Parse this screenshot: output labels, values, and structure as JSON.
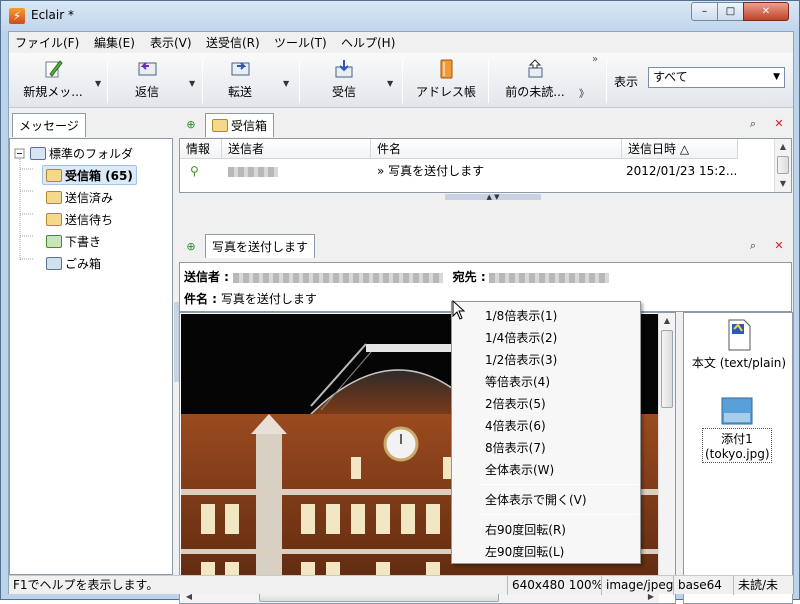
{
  "window": {
    "title": "Eclair *",
    "min": "–",
    "max": "□",
    "close": "✕"
  },
  "menu": [
    "ファイル(F)",
    "編集(E)",
    "表示(V)",
    "送受信(R)",
    "ツール(T)",
    "ヘルプ(H)"
  ],
  "toolbar": {
    "new_label": "新規メッ...",
    "reply_label": "返信",
    "forward_label": "転送",
    "receive_label": "受信",
    "address_label": "アドレス帳",
    "prev_unread_label": "前の未読...",
    "view_label": "表示",
    "view_selected": "すべて",
    "overflow": "»",
    "extra_label": "》"
  },
  "left": {
    "tab": "メッセージ",
    "folders": {
      "root": "標準のフォルダ",
      "inbox": "受信箱 (65)",
      "sent": "送信済み",
      "outbox": "送信待ち",
      "drafts": "下書き",
      "trash": "ごみ箱"
    }
  },
  "list": {
    "tab": "受信箱",
    "columns": {
      "info": "情報",
      "from": "送信者",
      "subject": "件名",
      "date": "送信日時 △"
    },
    "row": {
      "subject": "» 写真を送付します",
      "date": "2012/01/23 15:2..."
    }
  },
  "message": {
    "tab": "写真を送付します",
    "from_label": "送信者 :",
    "to_label": "宛先 :",
    "subject_label": "件名 :",
    "subject": "写真を送付します"
  },
  "attachments": {
    "body": "本文 (text/plain)",
    "attach1_line1": "添付1",
    "attach1_line2": "(tokyo.jpg)"
  },
  "context_menu": {
    "items_top": [
      "1/8倍表示(1)",
      "1/4倍表示(2)",
      "1/2倍表示(3)",
      "等倍表示(4)",
      "2倍表示(5)",
      "4倍表示(6)",
      "8倍表示(7)",
      "全体表示(W)"
    ],
    "open_full": "全体表示で開く(V)",
    "rotate_right": "右90度回転(R)",
    "rotate_left": "左90度回転(L)"
  },
  "status": {
    "help": "F1でヘルプを表示します。",
    "size": "640x480 100%",
    "mime": "image/jpeg",
    "encoding": "base64",
    "state": "未読/未"
  },
  "colors": {
    "accent": "#dce9f7",
    "title_bar": "#c1d6ec",
    "close": "#c3412b"
  }
}
